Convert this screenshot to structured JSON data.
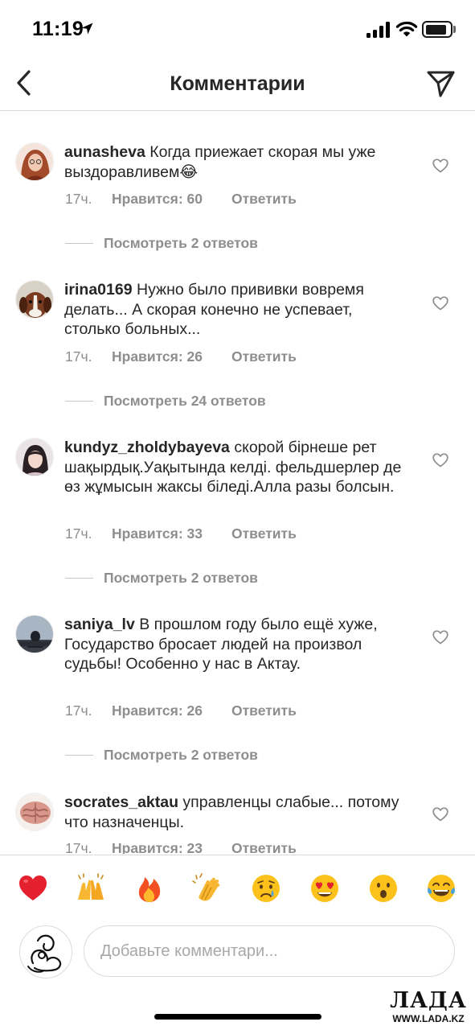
{
  "status_bar": {
    "time": "11:19"
  },
  "header": {
    "title": "Комментарии",
    "back_icon": "chevron-left-icon",
    "send_icon": "paper-plane-icon"
  },
  "comments": [
    {
      "username": "aunasheva",
      "text": " Когда приежает скорая мы уже выздоравливем😂",
      "time": "17ч.",
      "likes": "Нравится: 60",
      "reply": "Ответить",
      "replies": "Посмотреть 2 ответов"
    },
    {
      "username": "irina0169",
      "text": " Нужно было прививки вовремя делать... А скорая конечно не успевает, столько больных...",
      "time": "17ч.",
      "likes": "Нравится: 26",
      "reply": "Ответить",
      "replies": "Посмотреть 24 ответов"
    },
    {
      "username": "kundyz_zholdybayeva",
      "text": " скорой бірнеше рет шақырдық.Уақытында келді. фельдшерлер де өз жұмысын жаксы біледі.Алла разы болсын.",
      "time": "17ч.",
      "likes": "Нравится: 33",
      "reply": "Ответить",
      "replies": "Посмотреть 2 ответов"
    },
    {
      "username": "saniya_lv",
      "text": " В прошлом году было ещё хуже, Государство бросает людей на произвол судьбы! Особенно у нас в Актау.",
      "time": "17ч.",
      "likes": "Нравится: 26",
      "reply": "Ответить",
      "replies": "Посмотреть 2 ответов"
    },
    {
      "username": "socrates_aktau",
      "text": " управленцы слабые... потому что назначенцы.",
      "time": "17ч.",
      "likes": "Нравится: 23",
      "reply": "Ответить"
    }
  ],
  "emoji_bar": [
    "❤️",
    "🙌",
    "🔥",
    "👏",
    "😢",
    "😍",
    "😮",
    "😂"
  ],
  "composer": {
    "placeholder": "Добавьте комментари..."
  },
  "watermark": {
    "logo": "ЛАДА",
    "url": "WWW.LADA.KZ"
  },
  "colors": {
    "text": "#262626",
    "secondary": "#8e8e8e",
    "divider": "#dbdbdb"
  }
}
